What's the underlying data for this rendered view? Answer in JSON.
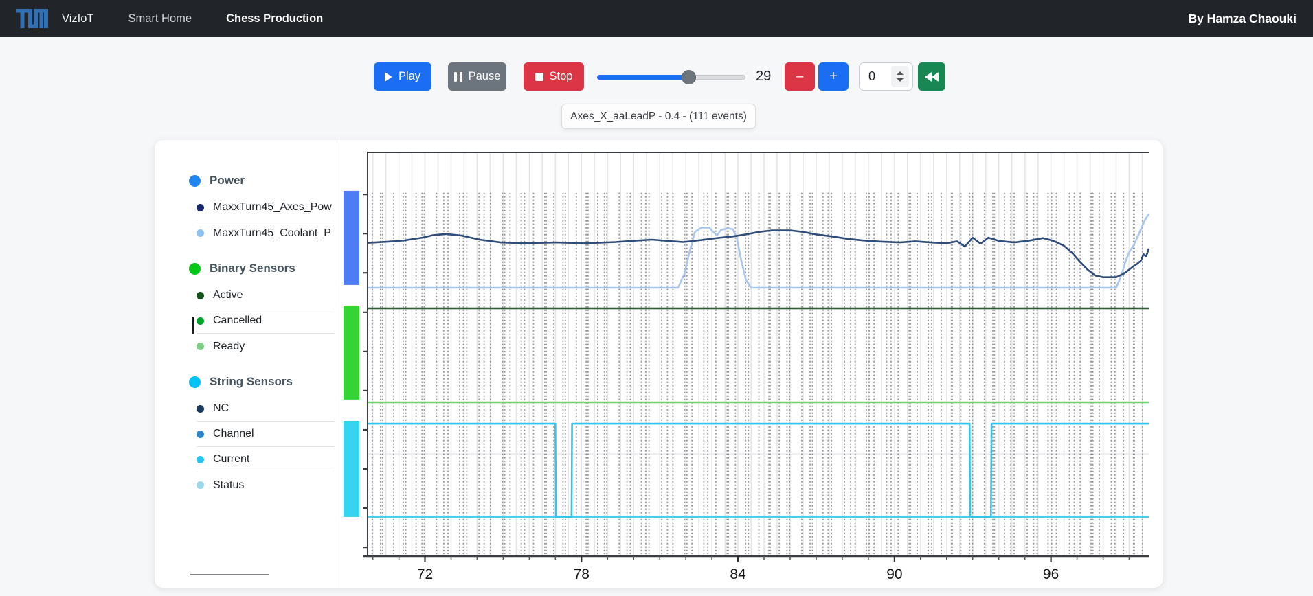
{
  "navbar": {
    "brand": "VizIoT",
    "brand_color": "#3070b3",
    "background": "#212529",
    "links": [
      {
        "label": "Smart Home",
        "active": false
      },
      {
        "label": "Chess Production",
        "active": true
      }
    ],
    "byline": "By Hamza Chaouki"
  },
  "controls": {
    "play": {
      "label": "Play",
      "color": "#1b6ef3"
    },
    "pause": {
      "label": "Pause",
      "color": "#6c757d"
    },
    "stop": {
      "label": "Stop",
      "color": "#dc3545"
    },
    "slider": {
      "value": 29,
      "fraction": 0.615
    },
    "counter": "29",
    "minus": {
      "label": "–",
      "color": "#dc3545"
    },
    "plus": {
      "label": "+",
      "color": "#1b6ef3"
    },
    "number_input": {
      "value": "0"
    },
    "rewind": {
      "color": "#198754"
    }
  },
  "tooltip": {
    "text": "Axes_X_aaLeadP - 0.4 - (111 events)"
  },
  "legend": {
    "groups": [
      {
        "label": "Power",
        "dot": "#2186f0",
        "items": [
          {
            "label": "MaxxTurn45_Axes_Pow",
            "dot": "#1b2a6c"
          },
          {
            "label": "MaxxTurn45_Coolant_P",
            "dot": "#8ec2f0"
          }
        ]
      },
      {
        "label": "Binary Sensors",
        "dot": "#00c718",
        "items": [
          {
            "label": "Active",
            "dot": "#14521c"
          },
          {
            "label": "Cancelled",
            "dot": "#00a32a"
          },
          {
            "label": "Ready",
            "dot": "#7ccf85"
          }
        ]
      },
      {
        "label": "String Sensors",
        "dot": "#00c4f5",
        "items": [
          {
            "label": "NC",
            "dot": "#1b3a5c"
          },
          {
            "label": "Channel",
            "dot": "#2e86c8"
          },
          {
            "label": "Current",
            "dot": "#27c4f0"
          },
          {
            "label": "Status",
            "dot": "#9ed8e8"
          }
        ]
      }
    ]
  },
  "chart_data": {
    "type": "line",
    "title": "",
    "xlabel": "",
    "ylabel": "",
    "x_domain": [
      69.8,
      99.75
    ],
    "x_major_ticks": [
      72,
      78,
      84,
      90,
      96
    ],
    "x_minor_step": 1,
    "grid_step": 0.5,
    "grid_on": true,
    "y_tick_fracs": [
      0.104,
      0.201,
      0.298,
      0.396,
      0.493,
      0.59,
      0.687,
      0.784,
      0.881,
      0.978
    ],
    "faint_hline_frac": 0.747,
    "events": {
      "count": 111,
      "style": "vertical-dotted",
      "y_frac_range": [
        0.1,
        0.995
      ]
    },
    "group_bars": [
      {
        "id": "power",
        "color": "#4d7cf5",
        "y_fracs": [
          0.095,
          0.328
        ]
      },
      {
        "id": "binary-sensors",
        "color": "#33d433",
        "y_fracs": [
          0.379,
          0.612
        ]
      },
      {
        "id": "string-sensors",
        "color": "#35d5f2",
        "y_fracs": [
          0.665,
          0.903
        ]
      }
    ],
    "series": [
      {
        "id": "status",
        "name": "Status",
        "color": "#49cdea",
        "width": 2.6,
        "points": [
          [
            69.8,
            0.903
          ],
          [
            99.75,
            0.903
          ]
        ]
      },
      {
        "id": "current",
        "name": "Current",
        "color": "#2fc6ea",
        "width": 2.6,
        "points": [
          [
            69.8,
            0.672
          ],
          [
            77.0,
            0.672
          ],
          [
            77.02,
            0.902
          ],
          [
            77.62,
            0.902
          ],
          [
            77.64,
            0.672
          ],
          [
            92.88,
            0.672
          ],
          [
            92.9,
            0.902
          ],
          [
            93.7,
            0.902
          ],
          [
            93.72,
            0.672
          ],
          [
            99.75,
            0.672
          ]
        ]
      },
      {
        "id": "ready",
        "name": "Ready",
        "color": "#6fd36f",
        "width": 2.4,
        "points": [
          [
            69.8,
            0.619
          ],
          [
            99.75,
            0.619
          ]
        ]
      },
      {
        "id": "cancelled",
        "name": "Cancelled",
        "color": "#18a52e",
        "width": 2.2,
        "points": [
          [
            69.8,
            0.386
          ],
          [
            99.75,
            0.386
          ]
        ]
      },
      {
        "id": "active",
        "name": "Active",
        "color": "#2f5e37",
        "width": 2.4,
        "points": [
          [
            69.8,
            0.386
          ],
          [
            99.75,
            0.386
          ]
        ]
      },
      {
        "id": "coolant",
        "name": "MaxxTurn45_Coolant_P",
        "color": "#a9c7ee",
        "width": 2.6,
        "points": [
          [
            69.8,
            0.335
          ],
          [
            81.7,
            0.335
          ],
          [
            81.95,
            0.3
          ],
          [
            82.15,
            0.245
          ],
          [
            82.35,
            0.197
          ],
          [
            82.6,
            0.186
          ],
          [
            82.9,
            0.186
          ],
          [
            83.05,
            0.197
          ],
          [
            83.2,
            0.205
          ],
          [
            83.35,
            0.192
          ],
          [
            83.6,
            0.188
          ],
          [
            83.8,
            0.19
          ],
          [
            83.95,
            0.21
          ],
          [
            84.1,
            0.26
          ],
          [
            84.3,
            0.315
          ],
          [
            84.5,
            0.335
          ],
          [
            98.5,
            0.335
          ],
          [
            98.7,
            0.305
          ],
          [
            98.85,
            0.272
          ],
          [
            99.0,
            0.247
          ],
          [
            99.15,
            0.232
          ],
          [
            99.3,
            0.212
          ],
          [
            99.45,
            0.19
          ],
          [
            99.6,
            0.168
          ],
          [
            99.75,
            0.152
          ]
        ]
      },
      {
        "id": "axes-power",
        "name": "MaxxTurn45_Axes_Pow",
        "color": "#2e4d7b",
        "width": 2.6,
        "points": [
          [
            69.8,
            0.224
          ],
          [
            70.6,
            0.221
          ],
          [
            71.2,
            0.218
          ],
          [
            71.9,
            0.211
          ],
          [
            72.3,
            0.205
          ],
          [
            72.8,
            0.202
          ],
          [
            73.4,
            0.206
          ],
          [
            74.1,
            0.216
          ],
          [
            74.9,
            0.223
          ],
          [
            75.8,
            0.225
          ],
          [
            77.0,
            0.223
          ],
          [
            78.2,
            0.225
          ],
          [
            79.3,
            0.222
          ],
          [
            80.2,
            0.218
          ],
          [
            80.7,
            0.216
          ],
          [
            81.3,
            0.219
          ],
          [
            81.9,
            0.222
          ],
          [
            82.6,
            0.217
          ],
          [
            83.2,
            0.212
          ],
          [
            83.8,
            0.208
          ],
          [
            84.3,
            0.203
          ],
          [
            84.8,
            0.197
          ],
          [
            85.3,
            0.193
          ],
          [
            86.0,
            0.193
          ],
          [
            86.5,
            0.197
          ],
          [
            87.0,
            0.203
          ],
          [
            87.6,
            0.208
          ],
          [
            88.2,
            0.214
          ],
          [
            88.8,
            0.218
          ],
          [
            89.5,
            0.221
          ],
          [
            90.2,
            0.223
          ],
          [
            90.8,
            0.22
          ],
          [
            91.4,
            0.223
          ],
          [
            92.0,
            0.225
          ],
          [
            92.4,
            0.22
          ],
          [
            92.7,
            0.233
          ],
          [
            93.0,
            0.211
          ],
          [
            93.3,
            0.226
          ],
          [
            93.6,
            0.211
          ],
          [
            94.0,
            0.219
          ],
          [
            94.6,
            0.223
          ],
          [
            95.2,
            0.218
          ],
          [
            95.7,
            0.212
          ],
          [
            96.1,
            0.219
          ],
          [
            96.5,
            0.231
          ],
          [
            96.8,
            0.248
          ],
          [
            97.1,
            0.27
          ],
          [
            97.4,
            0.29
          ],
          [
            97.7,
            0.305
          ],
          [
            98.0,
            0.309
          ],
          [
            98.5,
            0.309
          ],
          [
            98.8,
            0.3
          ],
          [
            99.1,
            0.285
          ],
          [
            99.3,
            0.276
          ],
          [
            99.45,
            0.268
          ],
          [
            99.55,
            0.252
          ],
          [
            99.65,
            0.258
          ],
          [
            99.75,
            0.238
          ]
        ]
      }
    ],
    "note": "Timing-diagram style plot; y values are lane-position fractions (0 = plot top). Cancelled overlaps Active; NC and Channel are not separately visible."
  }
}
